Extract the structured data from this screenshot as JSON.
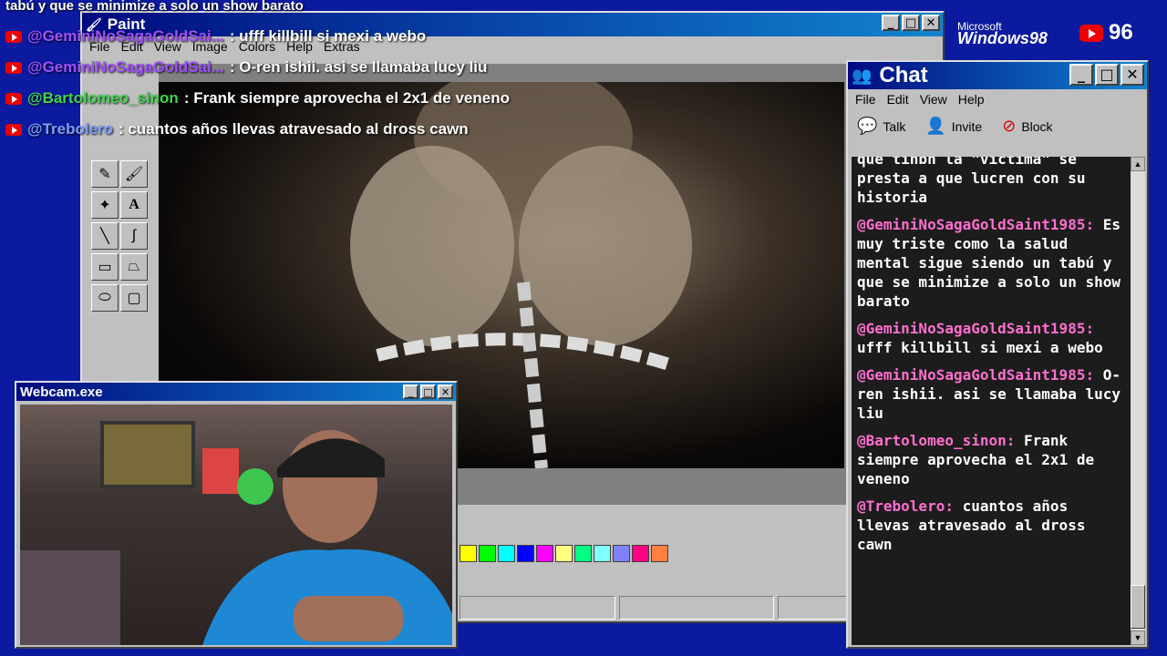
{
  "overlay": {
    "top_text": "tabú y que se minimize a solo un show barato",
    "lines": [
      {
        "user": "@GeminiNoSagaGoldSai...",
        "text": ": ufff killbill si mexi a webo",
        "color": "#a050ff"
      },
      {
        "user": "@GeminiNoSagaGoldSai...",
        "text": ": O-ren ishii. asi se llamaba lucy liu",
        "color": "#a050ff"
      },
      {
        "user": "@Bartolomeo_sinon",
        "text": ": Frank siempre aprovecha el 2x1 de veneno",
        "color": "#3ed64e"
      },
      {
        "user": "@Trebolero",
        "text": ": cuantos años llevas atravesado al dross cawn",
        "color": "#7aa0ff"
      }
    ]
  },
  "branding": {
    "microsoft": "Microsoft",
    "windows98": "Windows98",
    "subscriber_count": "96"
  },
  "paint": {
    "title": "Paint",
    "menu": [
      "File",
      "Edit",
      "View",
      "Image",
      "Colors",
      "Help",
      "Extras"
    ],
    "palette": [
      "#ffff00",
      "#00ff00",
      "#00ffff",
      "#0000ff",
      "#ff00ff",
      "#ffff80",
      "#00ff80",
      "#80ffff",
      "#8080ff",
      "#ff0080",
      "#ff8040"
    ]
  },
  "chat": {
    "title": "Chat",
    "menu": [
      "File",
      "Edit",
      "View",
      "Help"
    ],
    "toolbar": {
      "talk": "Talk",
      "invite": "Invite",
      "block": "Block"
    },
    "top_partial": "que tinbn la \"victima\" se presta a que lucren con su historia",
    "messages": [
      {
        "user": "@GeminiNoSagaGoldSaint1985:",
        "text": " Es muy triste como la salud mental sigue siendo un tabú y que se minimize a solo un show barato"
      },
      {
        "user": "@GeminiNoSagaGoldSaint1985:",
        "text": " ufff killbill si mexi a webo"
      },
      {
        "user": "@GeminiNoSagaGoldSaint1985:",
        "text": " O-ren ishii. asi se llamaba lucy liu"
      },
      {
        "user": "@Bartolomeo_sinon:",
        "text": " Frank siempre aprovecha el 2x1 de veneno"
      },
      {
        "user": "@Trebolero:",
        "text": " cuantos años llevas atravesado al dross cawn"
      }
    ]
  },
  "webcam": {
    "title": "Webcam.exe"
  }
}
